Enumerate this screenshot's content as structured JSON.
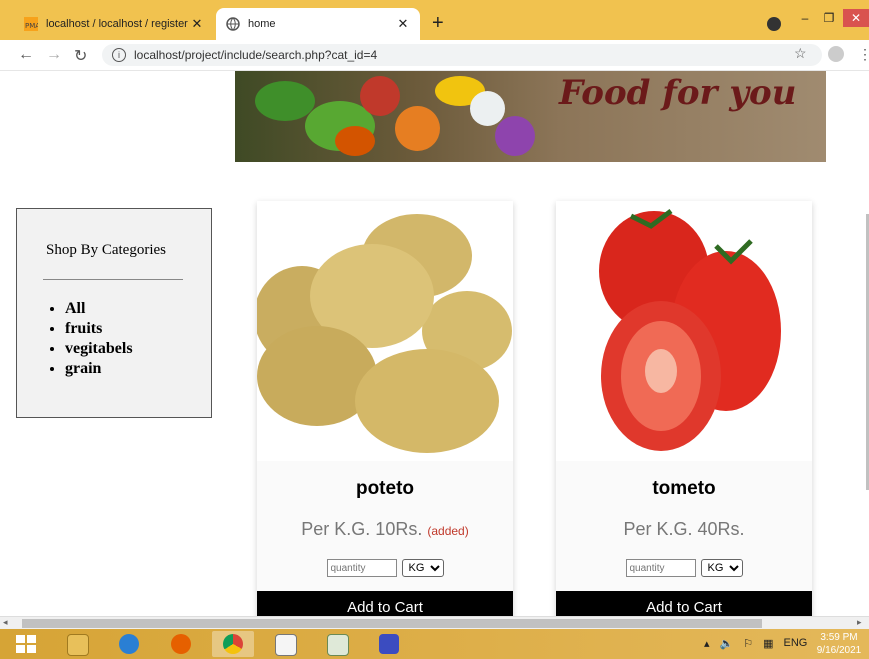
{
  "browser": {
    "tabs": [
      {
        "title": "localhost / localhost / register / s",
        "close": "✕"
      },
      {
        "title": "home",
        "close": "✕"
      }
    ],
    "new_tab": "+",
    "url": "localhost/project/include/search.php?cat_id=4"
  },
  "banner": {
    "title": "Food for you"
  },
  "sidebar": {
    "title": "Shop By Categories",
    "categories": [
      "All",
      "fruits",
      "vegitabels",
      "grain"
    ]
  },
  "products": [
    {
      "name": "poteto",
      "price": "Per K.G. 10Rs.",
      "status": "(added)",
      "qty_placeholder": "quantity",
      "unit": "KG",
      "button": "Add to Cart"
    },
    {
      "name": "tometo",
      "price": "Per K.G. 40Rs.",
      "status": "",
      "qty_placeholder": "quantity",
      "unit": "KG",
      "button": "Add to Cart"
    }
  ],
  "taskbar": {
    "lang": "ENG",
    "time": "3:59 PM",
    "date": "9/16/2021"
  }
}
